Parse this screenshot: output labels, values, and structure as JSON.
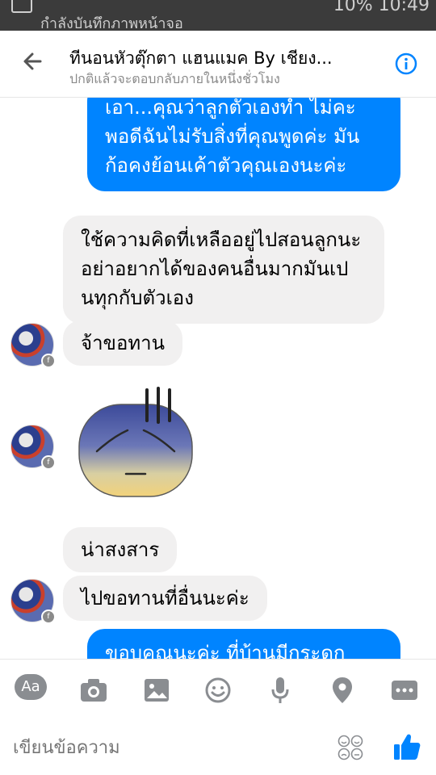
{
  "status_bar": {
    "notification_text": "กำลังบันทึกภาพหน้าจอ",
    "right_text": "10%  10:49"
  },
  "header": {
    "title": "ทีนอนหัวตุ๊กตา แฮนแมค By เชียง...",
    "subtitle": "ปกติแล้วจะตอบกลับภายในหนึ่งชั่วโมง"
  },
  "messages": [
    {
      "sender": "me",
      "text": "เอา...คุณว่าลูกตัวเองทำ ไม่คะ พอดีฉันไม่รับสิ่งที่คุณพูดค่ะ มันก้อคงย้อนเค้าตัวคุณเองนะค่ะ"
    },
    {
      "sender": "them",
      "text": "ใช้ความคิดที่เหลืออยู่ไปสอนลูกนะอย่าอยากได้ของคนอื่นมากมันเปนทุกกับตัวเอง"
    },
    {
      "sender": "them",
      "text": "จ้าขอทาน"
    },
    {
      "sender": "them",
      "sticker": "sad-face-sticker"
    },
    {
      "sender": "them",
      "text": "น่าสงสาร"
    },
    {
      "sender": "them",
      "text": "ไปขอทานที่อื่นนะค่ะ"
    },
    {
      "sender": "me",
      "text": "ขอบคุณนะค่ะ ที่บ้านมีกระดก"
    }
  ],
  "toolbar": {
    "aa_label": "Aa"
  },
  "compose": {
    "placeholder": "เขียนข้อความ"
  },
  "colors": {
    "accent": "#0084ff",
    "incoming_bubble": "#f1f0f0",
    "icon_gray": "#8a8d91"
  }
}
